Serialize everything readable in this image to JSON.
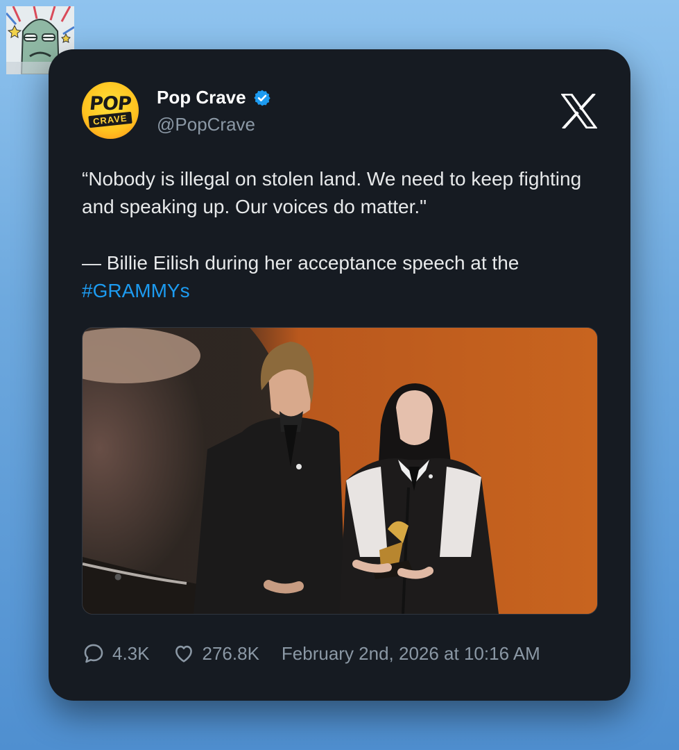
{
  "sticker": {
    "icon": "cartoon-fish-sticker-icon"
  },
  "tweet": {
    "author": {
      "name": "Pop Crave",
      "handle": "@PopCrave",
      "verified": true,
      "avatar_top_text": "POP",
      "avatar_bottom_text": "CRAVE",
      "verified_icon": "verified-badge-icon"
    },
    "platform_icon": "x-logo-icon",
    "text": {
      "quote_line": "“Nobody is illegal on stolen land. We need to keep fighting and speaking up. Our voices do matter.\"",
      "attribution": "— Billie Eilish during her acceptance speech at the",
      "hashtag": "#GRAMMYs"
    },
    "media": {
      "type": "photo",
      "icon": "photo-of-two-people-at-podium-image"
    },
    "stats": {
      "replies": "4.3K",
      "likes": "276.8K",
      "timestamp": "February 2nd, 2026 at 10:16 AM"
    }
  },
  "colors": {
    "card_bg": "#161b22",
    "text": "#e7e9ea",
    "muted": "#8b98a5",
    "link": "#1d9bf0",
    "verified": "#1d9bf0"
  }
}
